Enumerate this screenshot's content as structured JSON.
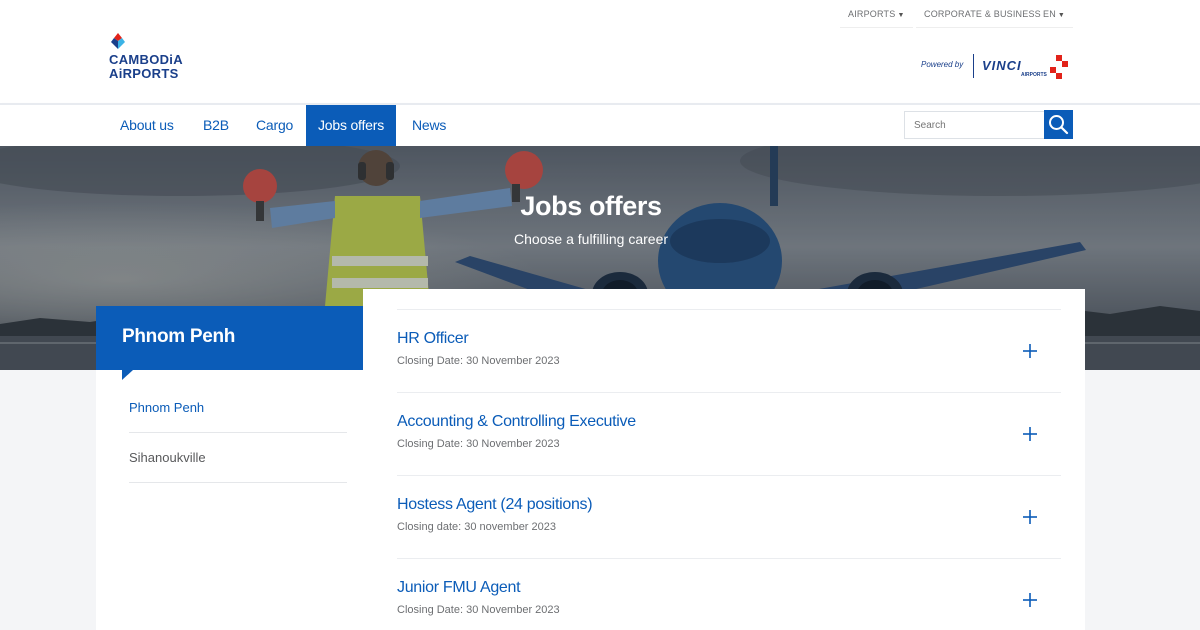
{
  "utility": {
    "airports": "AIRPORTS",
    "corporate": "CORPORATE & BUSINESS",
    "language": "EN"
  },
  "brand": {
    "line1": "CAMBODiA",
    "line2": "AiRPORTS",
    "powered_by": "Powered by",
    "vinci": "VINCI",
    "vinci_sub": "AIRPORTS"
  },
  "nav": {
    "items": [
      "About us",
      "B2B",
      "Cargo",
      "Jobs offers",
      "News"
    ],
    "active": "Jobs offers",
    "search_placeholder": "Search"
  },
  "hero": {
    "title": "Jobs offers",
    "subtitle": "Choose a fulfilling career"
  },
  "sidebar": {
    "heading": "Phnom Penh",
    "links": [
      "Phnom Penh",
      "Sihanoukville"
    ]
  },
  "jobs": [
    {
      "title": "HR Officer",
      "date": "Closing Date: 30 November 2023"
    },
    {
      "title": "Accounting & Controlling Executive",
      "date": "Closing Date: 30 November 2023"
    },
    {
      "title": "Hostess Agent (24 positions)",
      "date": "Closing date: 30 november 2023"
    },
    {
      "title": "Junior FMU Agent",
      "date": "Closing Date: 30 November 2023"
    }
  ],
  "colors": {
    "primary": "#0b5cb8",
    "brand_navy": "#1a3f8a",
    "accent_red": "#e2231a",
    "background": "#f4f5f7"
  }
}
